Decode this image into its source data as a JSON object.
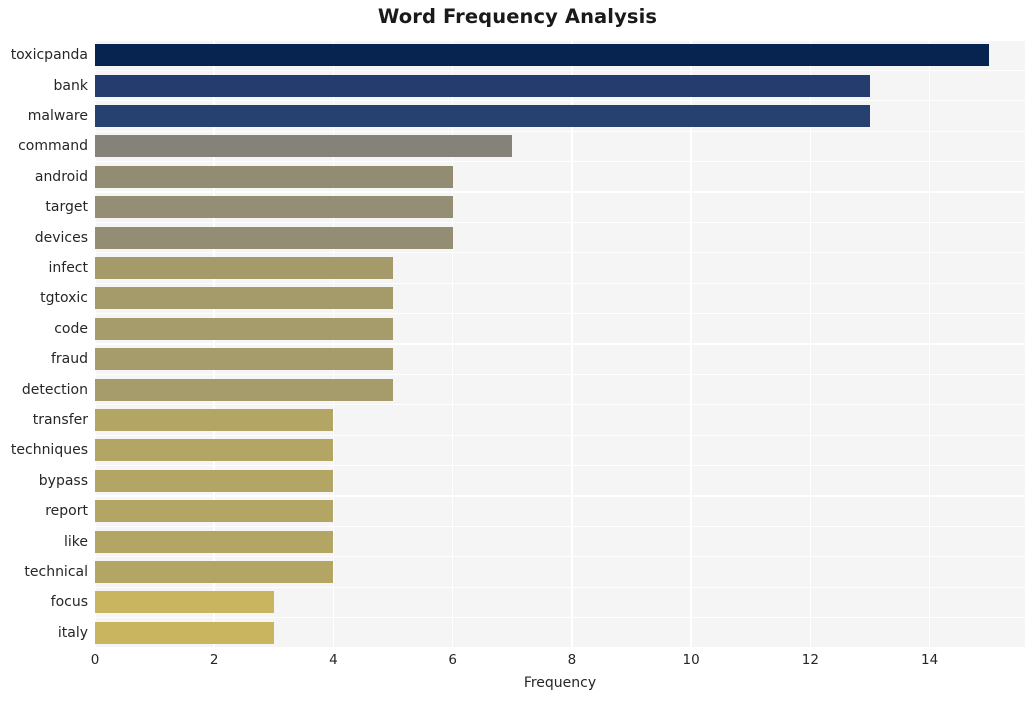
{
  "chart_data": {
    "type": "bar",
    "orientation": "horizontal",
    "title": "Word Frequency Analysis",
    "xlabel": "Frequency",
    "ylabel": "",
    "xlim": [
      0,
      15.6
    ],
    "ylim": [
      0,
      20
    ],
    "grid": true,
    "legend": null,
    "xticks": [
      "0",
      "2",
      "4",
      "6",
      "8",
      "10",
      "12",
      "14"
    ],
    "xtick_values": [
      0,
      2,
      4,
      6,
      8,
      10,
      12,
      14
    ],
    "categories": [
      "toxicpanda",
      "bank",
      "malware",
      "command",
      "android",
      "target",
      "devices",
      "infect",
      "tgtoxic",
      "code",
      "fraud",
      "detection",
      "transfer",
      "techniques",
      "bypass",
      "report",
      "like",
      "technical",
      "focus",
      "italy"
    ],
    "values": [
      15,
      13,
      13,
      7,
      6,
      6,
      6,
      5,
      5,
      5,
      5,
      5,
      4,
      4,
      4,
      4,
      4,
      4,
      3,
      3
    ],
    "colors": [
      "#06244f",
      "#243c6e",
      "#26406f",
      "#858379",
      "#928c72",
      "#948e74",
      "#938d73",
      "#a59a6a",
      "#a59a6a",
      "#a69b6b",
      "#a69b6b",
      "#a69b6b",
      "#b3a665",
      "#b3a665",
      "#b3a665",
      "#b3a665",
      "#b3a665",
      "#b3a665",
      "#c9b55f",
      "#c9b55f"
    ],
    "colormap": "cividis",
    "plot_background": "#f5f5f6",
    "figure_background": "#ffffff",
    "grid_color": "#ffffff",
    "text_color": "#262626"
  }
}
